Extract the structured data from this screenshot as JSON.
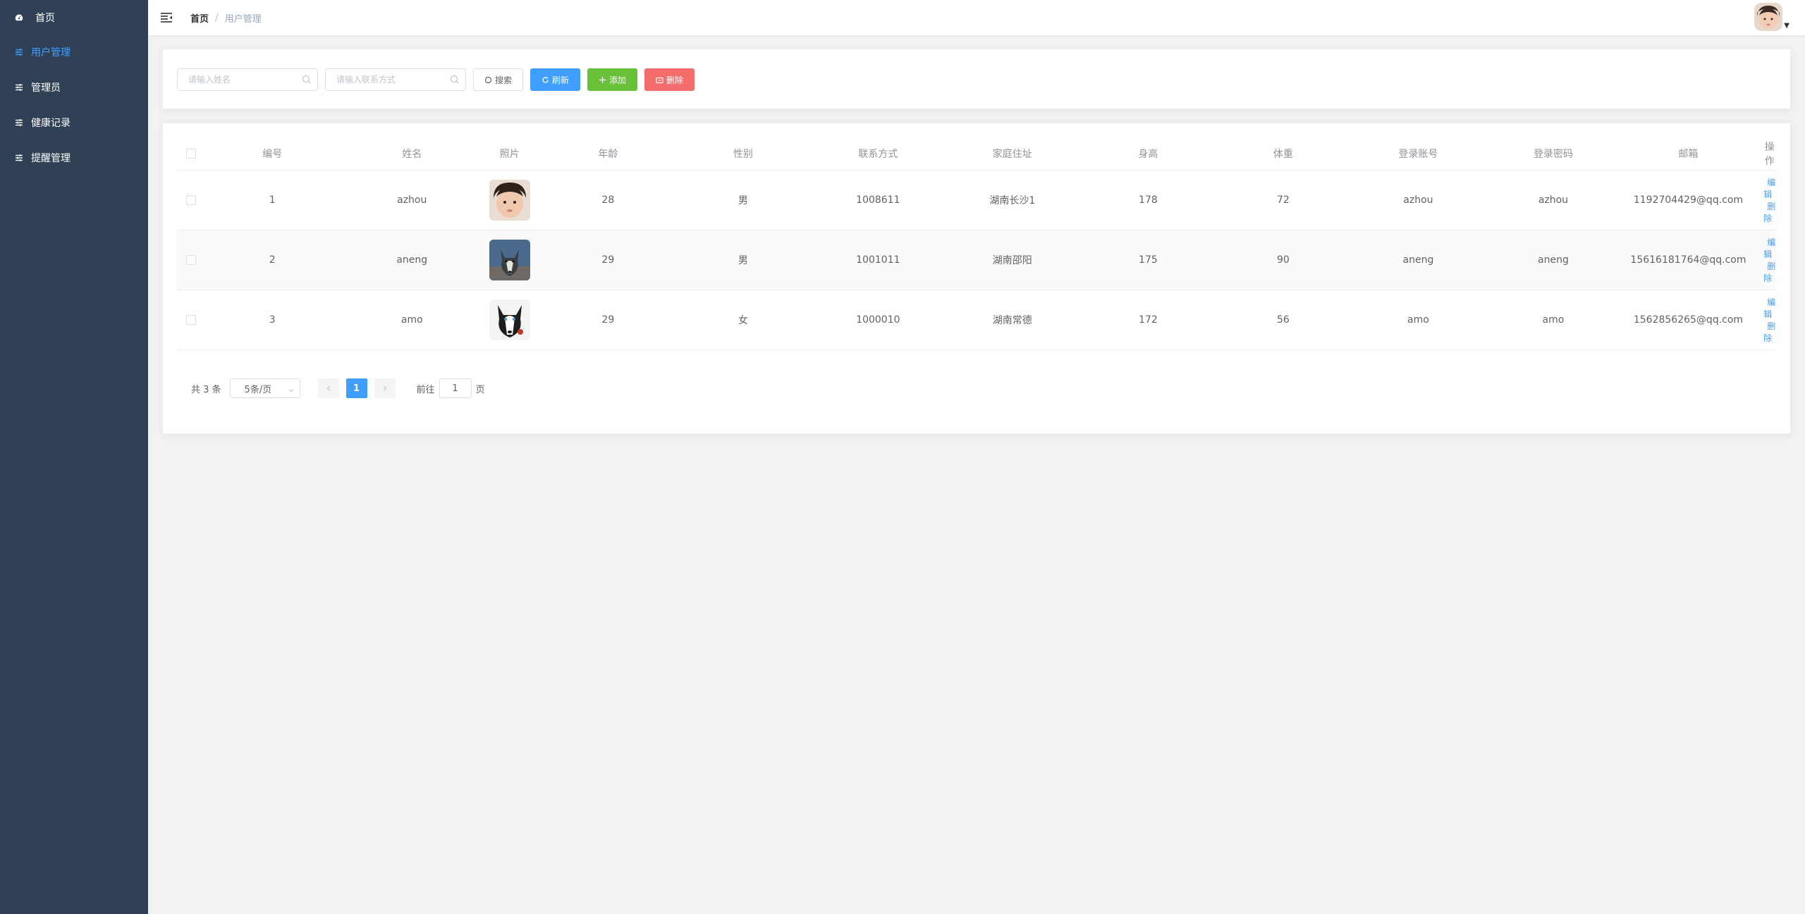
{
  "sidebar": {
    "items": [
      {
        "label": "首页",
        "icon": "dashboard-icon",
        "active": false
      },
      {
        "label": "用户管理",
        "icon": "sliders-icon",
        "active": true
      },
      {
        "label": "管理员",
        "icon": "sliders-icon",
        "active": false
      },
      {
        "label": "健康记录",
        "icon": "sliders-icon",
        "active": false
      },
      {
        "label": "提醒管理",
        "icon": "sliders-icon",
        "active": false
      }
    ],
    "colors": {
      "background": "#304156",
      "text": "#ffffff",
      "active": "#409eff"
    }
  },
  "header": {
    "breadcrumb": {
      "home": "首页",
      "separator": "/",
      "current": "用户管理"
    }
  },
  "search": {
    "name_placeholder": "请输入姓名",
    "phone_placeholder": "请输入联系方式",
    "search_label": "搜索",
    "refresh_label": "刷新",
    "add_label": "添加",
    "delete_label": "删除"
  },
  "table": {
    "columns": [
      "编号",
      "姓名",
      "照片",
      "年龄",
      "性别",
      "联系方式",
      "家庭住址",
      "身高",
      "体重",
      "登录账号",
      "登录密码",
      "邮箱",
      "操作"
    ],
    "rows": [
      {
        "id": "1",
        "name": "azhou",
        "age": "28",
        "gender": "男",
        "phone": "1008611",
        "address": "湖南长沙1",
        "height": "178",
        "weight": "72",
        "account": "azhou",
        "password": "azhou",
        "email": "1192704429@qq.com"
      },
      {
        "id": "2",
        "name": "aneng",
        "age": "29",
        "gender": "男",
        "phone": "1001011",
        "address": "湖南邵阳",
        "height": "175",
        "weight": "90",
        "account": "aneng",
        "password": "aneng",
        "email": "15616181764@qq.com"
      },
      {
        "id": "3",
        "name": "amo",
        "age": "29",
        "gender": "女",
        "phone": "1000010",
        "address": "湖南常德",
        "height": "172",
        "weight": "56",
        "account": "amo",
        "password": "amo",
        "email": "1562856265@qq.com"
      }
    ],
    "edit_label": "编辑",
    "delete_label": "删除"
  },
  "pagination": {
    "total_text": "共 3 条",
    "page_size": "5条/页",
    "current_page": "1",
    "goto_prefix": "前往",
    "goto_value": "1",
    "goto_suffix": "页"
  },
  "colors": {
    "primary": "#409eff",
    "success": "#67c23a",
    "danger": "#f56c6c"
  }
}
